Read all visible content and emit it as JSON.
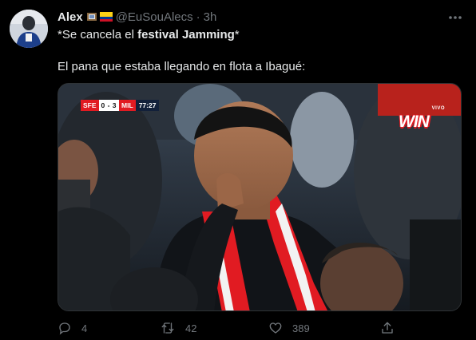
{
  "tweet": {
    "author": {
      "display_name": "Alex",
      "emoji_icons": [
        "framed-picture-emoji",
        "colombia-flag-emoji"
      ],
      "handle": "@EuSouAlecs",
      "separator": "·",
      "timestamp": "3h"
    },
    "text_line1": {
      "prefix": "*Se cancela el ",
      "bold": "festival Jamming",
      "suffix": "*"
    },
    "text_line2": "El pana que estaba llegando en flota a Ibagué:",
    "media": {
      "score_bug": {
        "home": "SFE",
        "score": "0 - 3",
        "away": "MIL",
        "clock": "77:27"
      },
      "broadcast_logo": {
        "top": "VIVO",
        "main": "WIN"
      }
    },
    "actions": {
      "reply_count": "4",
      "retweet_count": "42",
      "like_count": "389"
    }
  },
  "colors": {
    "background": "#000000",
    "primary_text": "#e7e9ea",
    "secondary_text": "#71767b",
    "scarf_red": "#e11b22"
  },
  "icons": {
    "more": "more-icon",
    "reply": "reply-icon",
    "retweet": "retweet-icon",
    "like": "heart-icon",
    "share": "share-icon"
  }
}
